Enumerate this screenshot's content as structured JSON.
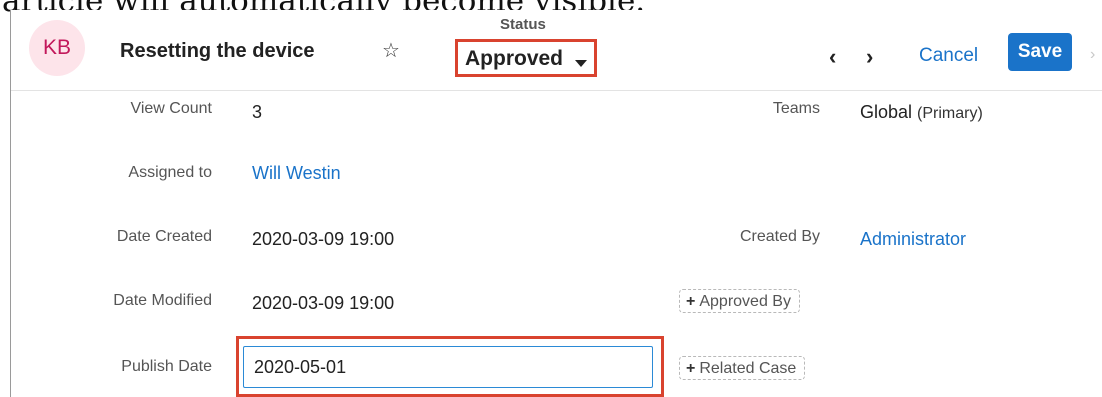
{
  "caption": "article will automatically become visible.",
  "header": {
    "avatar_initials": "KB",
    "title": "Resetting the device",
    "status_label": "Status",
    "status_value": "Approved",
    "prev_label": "‹",
    "next_label": "›",
    "cancel_label": "Cancel",
    "save_label": "Save"
  },
  "fields": {
    "view_count": {
      "label": "View Count",
      "value": "3"
    },
    "teams": {
      "label": "Teams",
      "value": "Global",
      "suffix": "(Primary)"
    },
    "assigned_to": {
      "label": "Assigned to",
      "value": "Will Westin"
    },
    "date_created": {
      "label": "Date Created",
      "value": "2020-03-09 19:00"
    },
    "created_by": {
      "label": "Created By",
      "value": "Administrator"
    },
    "date_modified": {
      "label": "Date Modified",
      "value": "2020-03-09 19:00"
    },
    "approved_by": {
      "label": "Approved By"
    },
    "publish_date": {
      "label": "Publish Date",
      "value": "2020-05-01"
    },
    "related_case": {
      "label": "Related Case"
    }
  },
  "colors": {
    "accent": "#1a73c9",
    "highlight": "#d9432f",
    "avatar_bg": "#fde4ea"
  }
}
